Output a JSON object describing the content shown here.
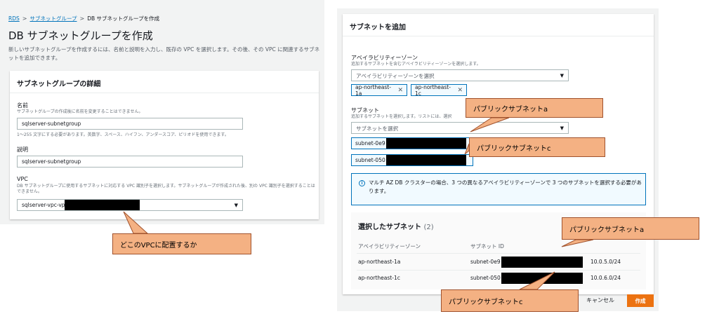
{
  "breadcrumb": {
    "rds": "RDS",
    "sep": ">",
    "subnet_groups": "サブネットグループ",
    "current": "DB サブネットグループを作成"
  },
  "page": {
    "title": "DB サブネットグループを作成",
    "description": "新しいサブネットグループを作成するには、名前と説明を入力し、既存の VPC を選択します。その後、その VPC に関連するサブネットを追加できます。"
  },
  "details": {
    "header": "サブネットグループの詳細",
    "name_label": "名前",
    "name_hint": "サブネットグループの作成後に名前を変更することはできません。",
    "name_value": "sqlserver-subnetgroup",
    "name_constraint": "1〜255 文字にする必要があります。英数字、スペース、ハイフン、アンダースコア、ピリオドを使用できます。",
    "desc_label": "説明",
    "desc_value": "sqlserver-subnetgroup",
    "vpc_label": "VPC",
    "vpc_hint": "DB サブネットグループに使用するサブネットに対応する VPC 識別子を選択します。サブネットグループが作成された後、別の VPC 識別子を選択することはできません。",
    "vpc_value": "sqlserver-vpc-vpc",
    "dropdown_arrow": "▼"
  },
  "add_subnets": {
    "header": "サブネットを追加",
    "az_label": "アベイラビリティーゾーン",
    "az_hint": "追加するサブネットを含むアベイラビリティーゾーンを選択します。",
    "az_placeholder": "アベイラビリティーゾーンを選択",
    "az_tokens": [
      "ap-northeast-1a",
      "ap-northeast-1c"
    ],
    "token_remove": "✕",
    "subnet_label": "サブネット",
    "subnet_hint": "追加するサブネットを選択します。リストには、選択",
    "subnet_placeholder": "サブネットを選択",
    "subnet_tokens": [
      "subnet-0e9",
      "subnet-050"
    ],
    "info_icon": "i",
    "info_text": "マルチ AZ DB クラスターの場合、3 つの異なるアベイラビリティーゾーンで 3 つのサブネットを選択する必要があります。"
  },
  "selected": {
    "title": "選択したサブネット",
    "count": "(2)",
    "col_az": "アベイラビリティーゾーン",
    "col_subnet": "サブネット ID",
    "rows": [
      {
        "az": "ap-northeast-1a",
        "subnet": "subnet-0e9",
        "cidr": "10.0.5.0/24"
      },
      {
        "az": "ap-northeast-1c",
        "subnet": "subnet-050",
        "cidr": "10.0.6.0/24"
      }
    ]
  },
  "actions": {
    "cancel": "キャンセル",
    "create": "作成"
  },
  "callouts": {
    "vpc": "どこのVPCに配置するか",
    "public_a_top": "パブリックサブネットa",
    "public_c_top": "パブリックサブネットc",
    "public_a_table": "パブリックサブネットa",
    "public_c_table": "パブリックサブネットc"
  },
  "colors": {
    "callout_fill": "#f4b183",
    "accent_blue": "#0073bb",
    "create_orange": "#ec7211"
  }
}
